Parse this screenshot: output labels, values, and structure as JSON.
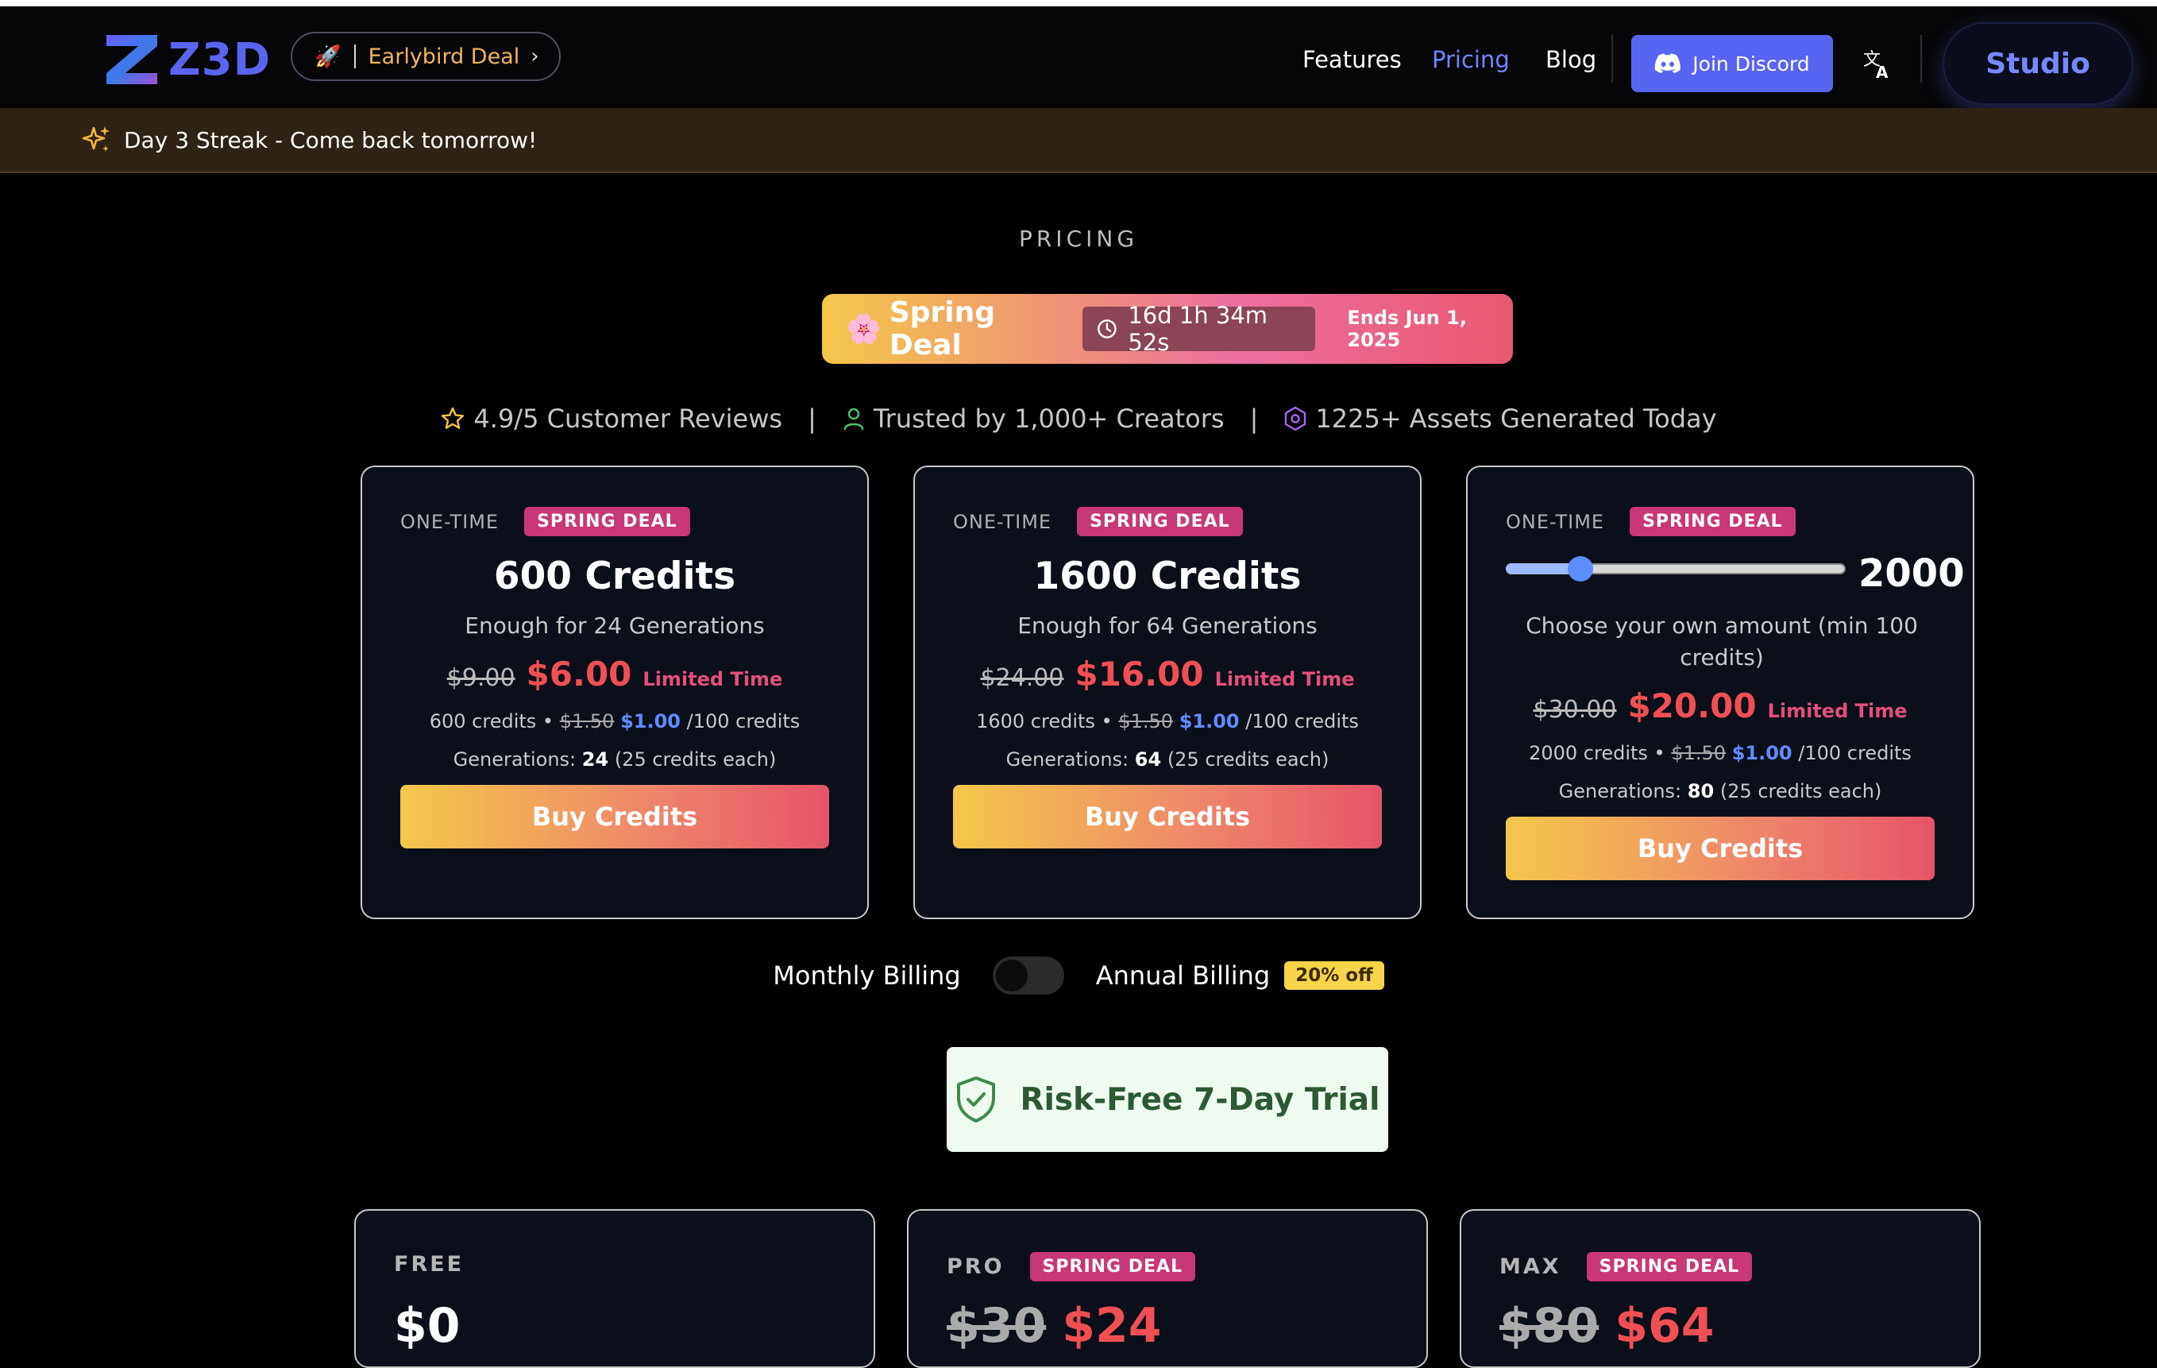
{
  "nav": {
    "brand": "Z3D",
    "earlybird_label": "Earlybird Deal",
    "links": [
      "Features",
      "Pricing",
      "Blog"
    ],
    "active_link": "Pricing",
    "discord_label": "Join Discord",
    "studio_label": "Studio"
  },
  "streak": {
    "text": "Day 3 Streak - Come back tomorrow!"
  },
  "pricing": {
    "eyebrow": "PRICING",
    "deal": {
      "name": "Spring Deal",
      "countdown": "16d 1h 34m 52s",
      "ends": "Ends Jun 1, 2025"
    },
    "trust": {
      "reviews": "4.9/5 Customer Reviews",
      "separator": "|",
      "creators": "Trusted by 1,000+ Creators",
      "assets": "1225+ Assets Generated Today"
    },
    "credit_cards": [
      {
        "type": "ONE-TIME",
        "badge": "SPRING DEAL",
        "title": "600 Credits",
        "subtitle": "Enough for 24 Generations",
        "old_price": "$9.00",
        "new_price": "$6.00",
        "limited": "Limited Time",
        "credits_text": "600 credits",
        "dot": "•",
        "rate_old": "$1.50",
        "rate_new": "$1.00",
        "rate_unit": "/100 credits",
        "gens_label": "Generations:",
        "gens_value": "24",
        "gens_note": "(25 credits each)",
        "button": "Buy Credits"
      },
      {
        "type": "ONE-TIME",
        "badge": "SPRING DEAL",
        "title": "1600 Credits",
        "subtitle": "Enough for 64 Generations",
        "old_price": "$24.00",
        "new_price": "$16.00",
        "limited": "Limited Time",
        "credits_text": "1600 credits",
        "dot": "•",
        "rate_old": "$1.50",
        "rate_new": "$1.00",
        "rate_unit": "/100 credits",
        "gens_label": "Generations:",
        "gens_value": "64",
        "gens_note": "(25 credits each)",
        "button": "Buy Credits"
      },
      {
        "type": "ONE-TIME",
        "badge": "SPRING DEAL",
        "amount": "2000",
        "slider_fraction": 0.2,
        "subtitle": "Choose your own amount (min 100 credits)",
        "old_price": "$30.00",
        "new_price": "$20.00",
        "limited": "Limited Time",
        "credits_text": "2000 credits",
        "dot": "•",
        "rate_old": "$1.50",
        "rate_new": "$1.00",
        "rate_unit": "/100 credits",
        "gens_label": "Generations:",
        "gens_value": "80",
        "gens_note": "(25 credits each)",
        "button": "Buy Credits"
      }
    ],
    "billing": {
      "monthly": "Monthly Billing",
      "annual": "Annual Billing",
      "discount": "20% off",
      "annual_on": false
    },
    "trial": "Risk-Free 7-Day Trial",
    "plans": [
      {
        "name": "FREE",
        "badge": "",
        "old_price": "",
        "price": "$0"
      },
      {
        "name": "PRO",
        "badge": "SPRING DEAL",
        "old_price": "$30",
        "price": "$24"
      },
      {
        "name": "MAX",
        "badge": "SPRING DEAL",
        "old_price": "$80",
        "price": "$64"
      }
    ]
  },
  "colors": {
    "accent": "#5b64ee",
    "deal_red": "#f04f55",
    "badge_pink": "#c83777",
    "discord": "#5865f2"
  }
}
